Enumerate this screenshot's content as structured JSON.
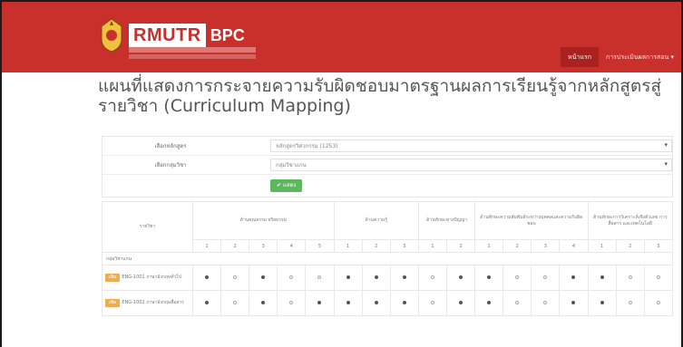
{
  "header": {
    "logo_main": "RMUTR",
    "logo_sub": "BPC",
    "nav": [
      {
        "label": "หน้าแรก",
        "active": true
      },
      {
        "label": "การประเมินผลการสอน ▾",
        "active": false
      }
    ]
  },
  "page": {
    "title": "แผนที่แสดงการกระจายความรับผิดชอบมาตรฐานผลการเรียนรู้จากหลักสูตรสู่รายวิชา (Curriculum Mapping)"
  },
  "form": {
    "fields": [
      {
        "label": "เลือกหลักสูตร",
        "value": "หลักสูตรวิศวกรรม (1253)"
      },
      {
        "label": "เลือกกลุ่มวิชา",
        "value": "กลุ่มวิชาแกน"
      }
    ],
    "submit_label": "✔ แสดง"
  },
  "table": {
    "course_header": "รายวิชา",
    "groups": [
      {
        "label": "ด้านคุณธรรม จริยธรรม",
        "nums": [
          "1",
          "2",
          "3",
          "4",
          "5"
        ]
      },
      {
        "label": "ด้านความรู้",
        "nums": [
          "1",
          "2",
          "3"
        ]
      },
      {
        "label": "ด้านทักษะทางปัญญา",
        "nums": [
          "1",
          "2"
        ]
      },
      {
        "label": "ด้านทักษะความสัมพันธ์ระหว่างบุคคลและความรับผิดชอบ",
        "nums": [
          "1",
          "2",
          "3",
          "4"
        ]
      },
      {
        "label": "ด้านทักษะการวิเคราะห์เชิงตัวเลข การสื่อสาร และเทคโนโลยี",
        "nums": [
          "1",
          "2",
          "3"
        ]
      }
    ],
    "section_label": "กลุ่มวิชาแกน",
    "rows": [
      {
        "detail": "เพิ่ม",
        "course": "ENG-1001 ภาษาอังกฤษทั่วไป",
        "marks": [
          "F",
          "E",
          "F",
          "E",
          "E",
          "F",
          "F",
          "F",
          "E",
          "F",
          "F",
          "E",
          "E",
          "F",
          "F",
          "E",
          "E"
        ]
      },
      {
        "detail": "เพิ่ม",
        "course": "ENG-1002 ภาษาอังกฤษสื่อสาร",
        "marks": [
          "F",
          "E",
          "F",
          "E",
          "F",
          "F",
          "F",
          "F",
          "E",
          "F",
          "F",
          "E",
          "E",
          "F",
          "F",
          "E",
          "E"
        ]
      }
    ]
  },
  "colors": {
    "brand": "#c9302c",
    "submit": "#5cb85c",
    "detail": "#f0ad4e"
  }
}
